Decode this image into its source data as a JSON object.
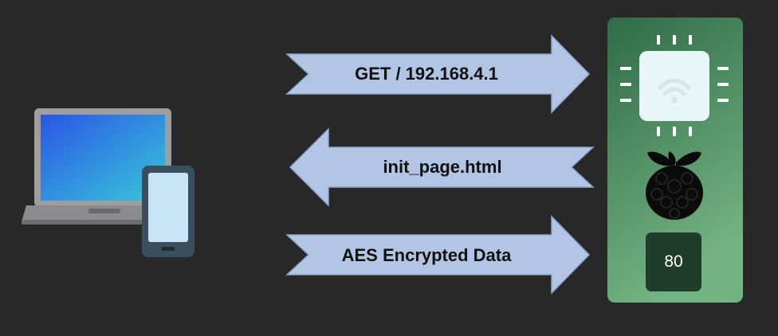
{
  "diagram": {
    "arrows": [
      {
        "direction": "right",
        "label": "GET / 192.168.4.1"
      },
      {
        "direction": "left",
        "label": "init_page.html"
      },
      {
        "direction": "right",
        "label": "AES Encrypted Data"
      }
    ],
    "server": {
      "icons": [
        "wifi-chip-icon",
        "raspberry-pi-icon"
      ],
      "port_label": "80"
    },
    "client": {
      "icons": [
        "laptop-icon",
        "smartphone-icon"
      ]
    },
    "colors": {
      "background": "#282828",
      "arrow_fill": "#b3c5e4",
      "arrow_stroke": "#8fa6cf",
      "board_top": "#2f6b47",
      "board_bottom": "#74b383",
      "port_box": "#1f3d2b"
    }
  }
}
